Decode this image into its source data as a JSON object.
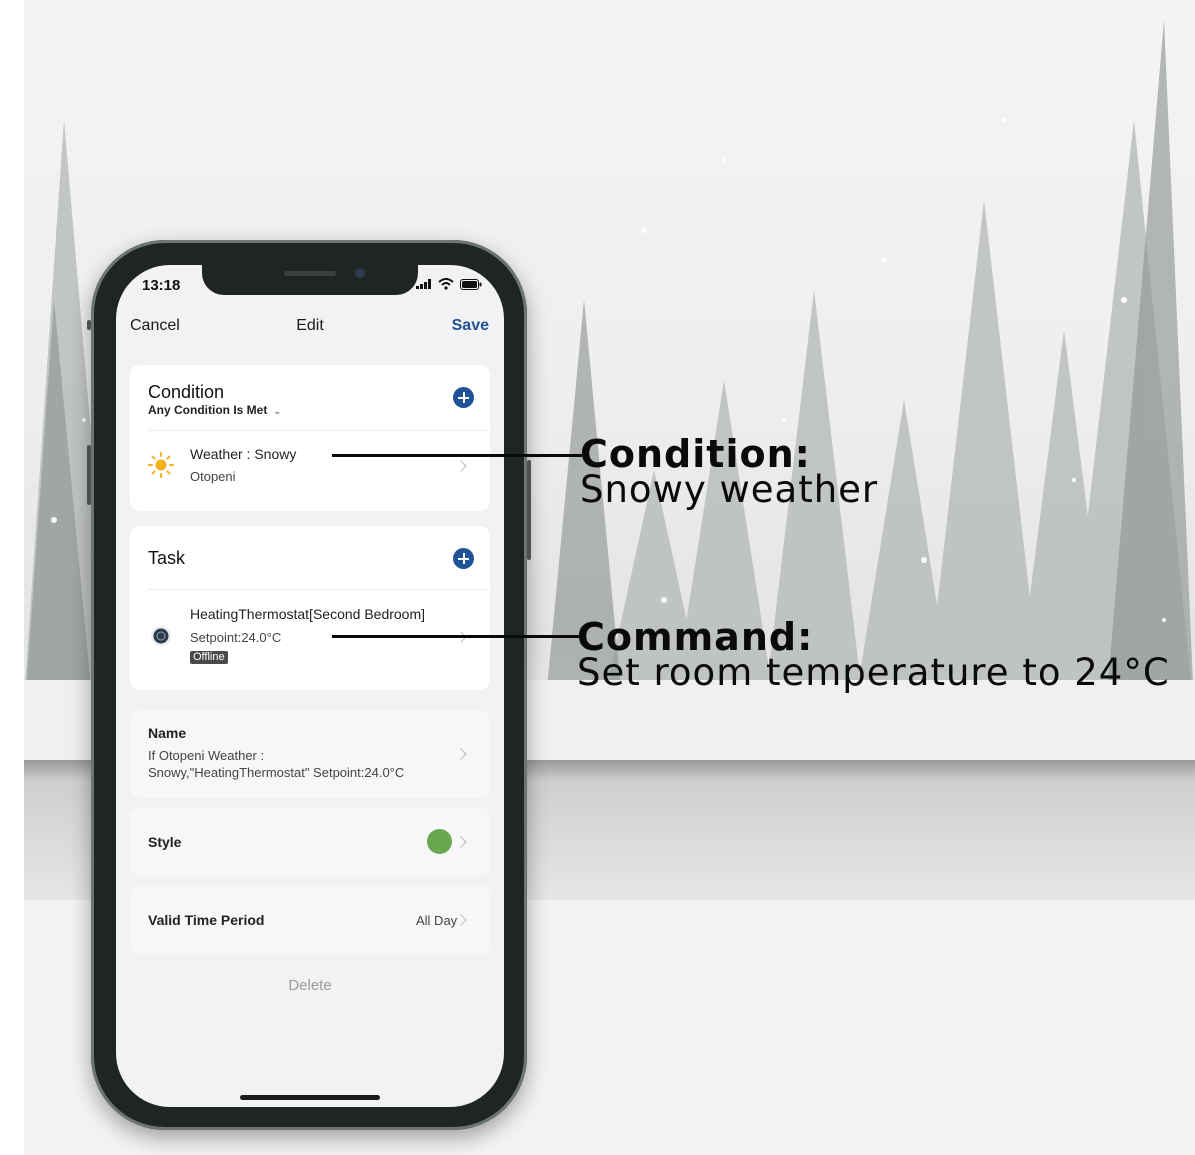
{
  "status": {
    "time": "13:18"
  },
  "nav": {
    "cancel": "Cancel",
    "title": "Edit",
    "save": "Save"
  },
  "condition": {
    "title": "Condition",
    "mode": "Any Condition Is Met",
    "item": {
      "label": "Weather : Snowy",
      "location": "Otopeni",
      "icon": "sun-icon"
    }
  },
  "task": {
    "title": "Task",
    "item": {
      "device": "HeatingThermostat[Second Bedroom]",
      "setpoint": "Setpoint:24.0°C",
      "status": "Offline",
      "icon": "thermostat-icon"
    }
  },
  "name": {
    "label": "Name",
    "line1": "If Otopeni Weather :",
    "line2": "Snowy,\"HeatingThermostat\" Setpoint:24.0°C"
  },
  "style": {
    "label": "Style",
    "color": "#6aa84f"
  },
  "valid_time": {
    "label": "Valid Time Period",
    "value": "All Day"
  },
  "delete": "Delete",
  "callouts": {
    "condition": {
      "heading": "Condition:",
      "text": "Snowy weather"
    },
    "command": {
      "heading": "Command:",
      "text": "Set room temperature to 24°C"
    }
  },
  "colors": {
    "accent": "#1f5296",
    "badge": "#4a4a4a",
    "sun": "#f2b21b"
  }
}
